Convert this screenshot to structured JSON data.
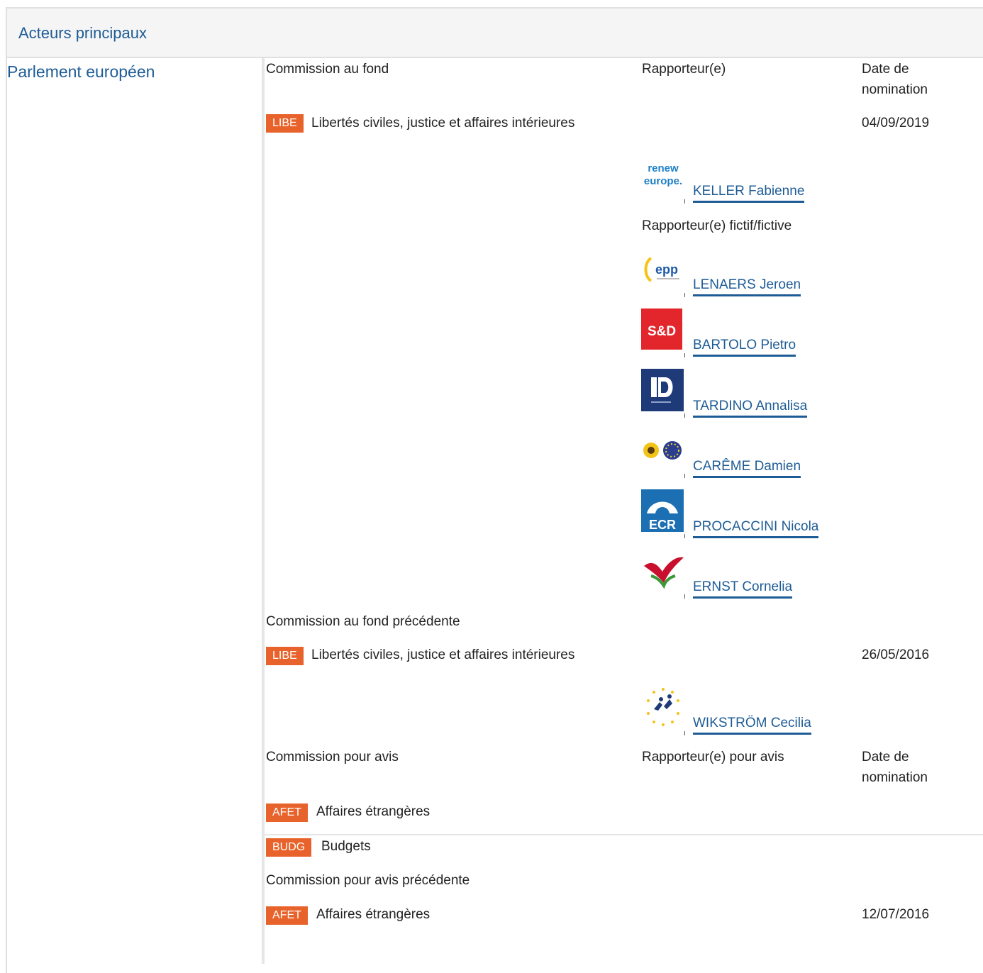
{
  "header": {
    "title": "Acteurs principaux"
  },
  "institution": "Parlement européen",
  "lead": {
    "commission_header": "Commission au fond",
    "rapporteur_header": "Rapporteur(e)",
    "date_header_line1": "Date de",
    "date_header_line2": "nomination",
    "committee": {
      "code": "LIBE",
      "name": "Libertés civiles, justice et affaires intérieures",
      "date": "04/09/2019"
    },
    "rapporteur": {
      "name": "KELLER Fabienne",
      "group_logo": "renew-europe-logo"
    },
    "shadow_header": "Rapporteur(e) fictif/fictive",
    "shadows": [
      {
        "name": "LENAERS Jeroen",
        "group_logo": "epp-logo"
      },
      {
        "name": "BARTOLO Pietro",
        "group_logo": "s-and-d-logo"
      },
      {
        "name": "TARDINO Annalisa",
        "group_logo": "id-logo"
      },
      {
        "name": "CARÊME Damien",
        "group_logo": "greens-efa-logo"
      },
      {
        "name": "PROCACCINI Nicola",
        "group_logo": "ecr-logo"
      },
      {
        "name": "ERNST Cornelia",
        "group_logo": "gue-ngl-logo"
      }
    ]
  },
  "previous_lead": {
    "header": "Commission au fond précédente",
    "committee": {
      "code": "LIBE",
      "name": "Libertés civiles, justice et affaires intérieures",
      "date": "26/05/2016"
    },
    "rapporteur": {
      "name": "WIKSTRÖM Cecilia",
      "group_logo": "alde-logo"
    }
  },
  "opinion": {
    "commission_header": "Commission pour avis",
    "rapporteur_header": "Rapporteur(e) pour avis",
    "date_header_line1": "Date de",
    "date_header_line2": "nomination",
    "committees": [
      {
        "code": "AFET",
        "name": "Affaires étrangères"
      },
      {
        "code": "BUDG",
        "name": "Budgets"
      }
    ]
  },
  "previous_opinion": {
    "header": "Commission pour avis précédente",
    "committee": {
      "code": "AFET",
      "name": "Affaires étrangères",
      "date": "12/07/2016"
    }
  },
  "colors": {
    "badge": "#e8632b",
    "link": "#1e5c96",
    "separator": "#e6e6e6"
  }
}
